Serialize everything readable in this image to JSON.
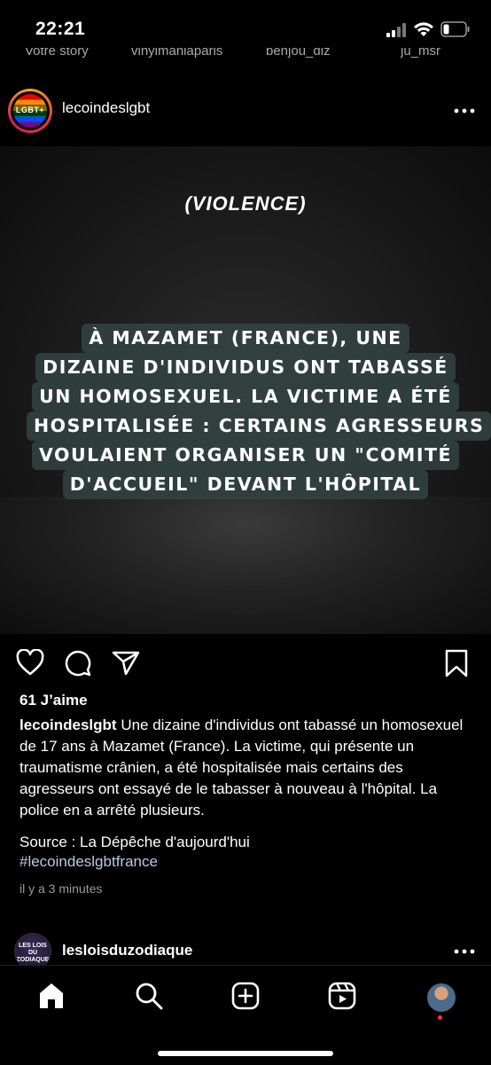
{
  "status_bar": {
    "time": "22:21"
  },
  "stories": [
    "Votre story",
    "vinylmaniaparis",
    "benjou_diz",
    "ju_msr"
  ],
  "post": {
    "username": "lecoindeslgbt",
    "avatar_text": "LGBT+",
    "image": {
      "tag": "(VIOLENCE)",
      "headline_lines": [
        "À MAZAMET (FRANCE), UNE",
        "DIZAINE D'INDIVIDUS ONT TABASSÉ",
        "UN HOMOSEXUEL. LA VICTIME A ÉTÉ",
        "HOSPITALISÉE : CERTAINS AGRESSEURS",
        "VOULAIENT ORGANISER UN \"COMITÉ",
        "D'ACCUEIL\" DEVANT L'HÔPITAL"
      ]
    },
    "likes": "61 J’aime",
    "caption_user": "lecoindeslgbt",
    "caption_text": "Une dizaine d'individus ont tabassé un homosexuel de 17 ans à Mazamet (France). La victime, qui présente un traumatisme crânien, a été hospitalisée mais certains des agresseurs ont essayé de le tabasser à nouveau à l'hôpital. La police en a arrêté plusieurs.",
    "source": "Source : La Dépêche d'aujourd'hui",
    "hashtag": "#lecoindeslgbtfrance",
    "timestamp": "il y a 3 minutes"
  },
  "next_post": {
    "username": "lesloisduzodiaque",
    "avatar_text": "LES LOIS DU ZODIAQUE"
  },
  "icons": {
    "actions": [
      "heart-icon",
      "comment-icon",
      "share-icon",
      "bookmark-icon"
    ],
    "tabs": [
      "home-icon",
      "search-icon",
      "create-icon",
      "reels-icon",
      "profile-avatar"
    ]
  }
}
